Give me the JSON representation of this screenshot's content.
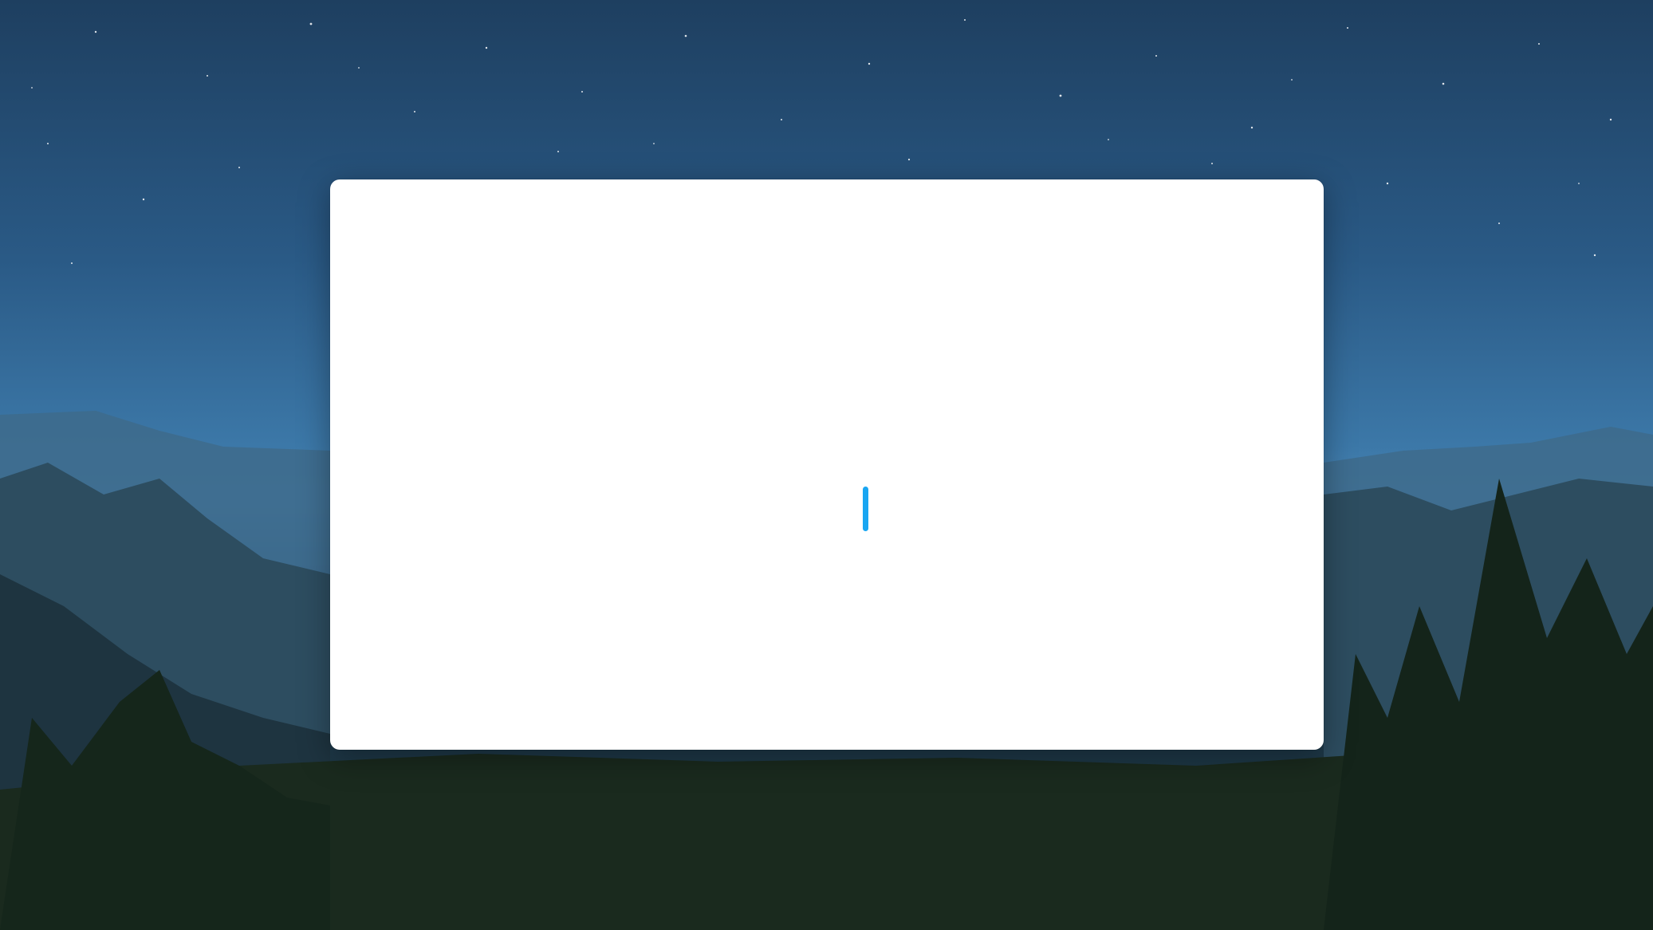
{
  "wallpaper": {
    "description": "night-sky-mountain-forest",
    "sky_color": "#2a5a86",
    "forest_color": "#14241a"
  },
  "editor": {
    "text": "",
    "cursor_color": "#19a6f2",
    "background_color": "#ffffff"
  }
}
